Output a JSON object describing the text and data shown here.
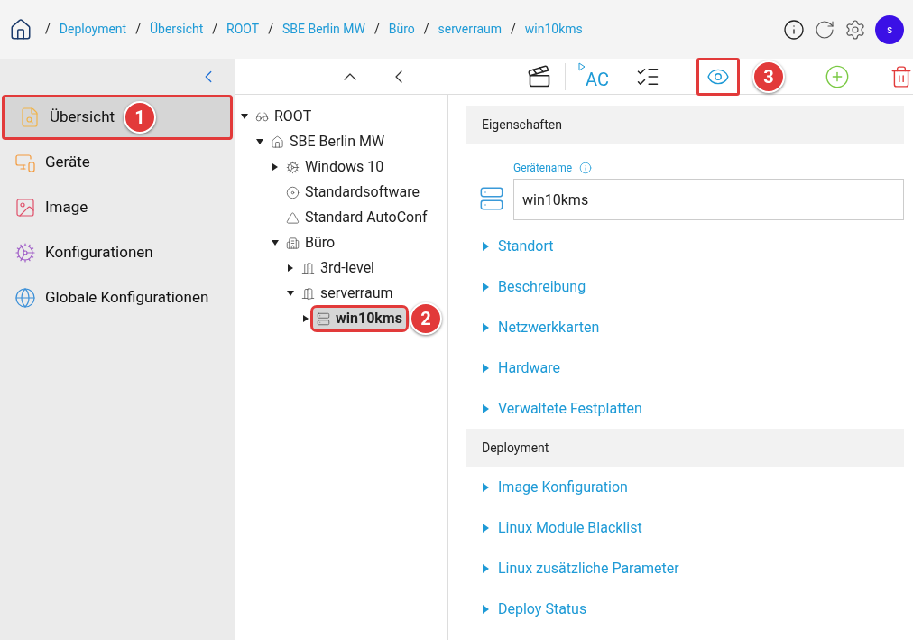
{
  "breadcrumb": {
    "separator": "/",
    "items": [
      "Deployment",
      "Übersicht",
      "ROOT",
      "SBE Berlin MW",
      "Büro",
      "serverraum",
      "win10kms"
    ]
  },
  "account": {
    "initial": "s"
  },
  "sidebar": {
    "items": [
      {
        "label": "Übersicht",
        "kind": "overview",
        "selected": true,
        "callout": "1"
      },
      {
        "label": "Geräte",
        "kind": "devices",
        "selected": false
      },
      {
        "label": "Image",
        "kind": "image",
        "selected": false
      },
      {
        "label": "Konfigurationen",
        "kind": "config",
        "selected": false
      },
      {
        "label": "Globale Konfigurationen",
        "kind": "global",
        "selected": false
      }
    ]
  },
  "toolbar": {
    "autoconf_label": "AC",
    "view_highlighted": true,
    "view_callout": "3"
  },
  "tree": [
    {
      "label": "ROOT",
      "kind": "root",
      "expanded": true,
      "selected": false,
      "children": [
        {
          "label": "SBE Berlin MW",
          "kind": "house",
          "expanded": true,
          "selected": false,
          "children": [
            {
              "label": "Windows 10",
              "kind": "gear",
              "expanded": false,
              "selected": false
            },
            {
              "label": "Standardsoftware",
              "kind": "disc",
              "selected": false
            },
            {
              "label": "Standard AutoConf",
              "kind": "autoconf",
              "selected": false
            },
            {
              "label": "Büro",
              "kind": "building",
              "expanded": true,
              "selected": false,
              "children": [
                {
                  "label": "3rd-level",
                  "kind": "room",
                  "expanded": false,
                  "selected": false
                },
                {
                  "label": "serverraum",
                  "kind": "room",
                  "expanded": true,
                  "selected": false,
                  "children": [
                    {
                      "label": "win10kms",
                      "kind": "server",
                      "expanded": false,
                      "selected": true,
                      "callout": "2"
                    }
                  ]
                }
              ]
            }
          ]
        }
      ]
    }
  ],
  "details": {
    "sections": [
      {
        "title": "Eigenschaften",
        "field": {
          "label": "Gerätename",
          "value": "win10kms"
        },
        "groups": [
          "Standort",
          "Beschreibung",
          "Netzwerkkarten",
          "Hardware",
          "Verwaltete Festplatten"
        ]
      },
      {
        "title": "Deployment",
        "groups": [
          "Image Konfiguration",
          "Linux Module Blacklist",
          "Linux zusätzliche Parameter",
          "Deploy Status"
        ]
      }
    ]
  }
}
